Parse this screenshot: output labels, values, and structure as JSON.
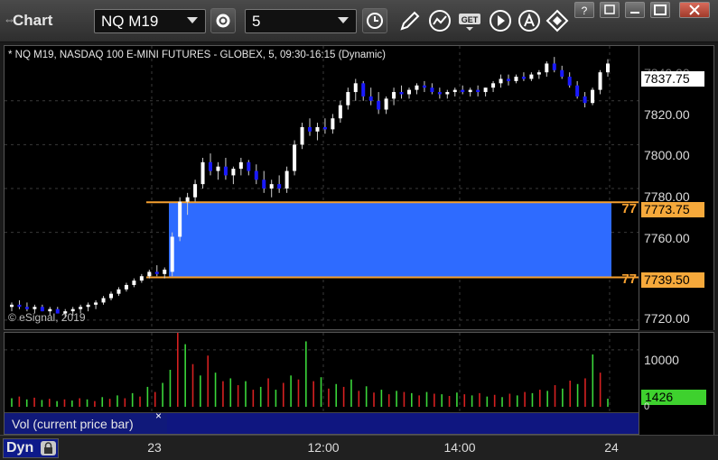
{
  "app": {
    "title": "Chart"
  },
  "toolbar": {
    "symbol": "NQ M19",
    "interval": "5",
    "icons": [
      "gear-icon",
      "clock-icon",
      "pencil-icon",
      "study-icon",
      "get-icon",
      "play-icon",
      "autoscale-icon",
      "cursor-icon"
    ],
    "window_icons": [
      "help-icon",
      "restore-icon",
      "maximize-icon",
      "close-icon"
    ]
  },
  "chart": {
    "header": "* NQ M19, NASDAQ 100 E-MINI FUTURES - GLOBEX, 5, 09:30-16:15 (Dynamic)",
    "copyright": "© eSignal, 2019",
    "price_axis": {
      "ticks": [
        "7820.00",
        "7800.00",
        "7780.00",
        "7760.00",
        "7720.00"
      ],
      "partial_top": "7840.00",
      "last_price": "7837.75",
      "upper_level": "7773.75",
      "lower_level": "7739.50",
      "upper_level_short": "77",
      "lower_level_short": "77"
    },
    "colors": {
      "up_bar": "#ffffff",
      "down_bar": "#1a1aff",
      "zone": "#2e6bff",
      "level_line": "#f5a030"
    }
  },
  "volume": {
    "legend_label": "Vol (current price bar)",
    "close_glyph": "×",
    "axis_tick": "10000",
    "axis_zero": "0",
    "current_value": "1426",
    "colors": {
      "up": "#3ad63a",
      "down": "#d62020"
    }
  },
  "time_axis": {
    "dyn_label": "Dyn",
    "ticks": [
      "23",
      "12:00",
      "14:00",
      "24"
    ]
  },
  "chart_data": {
    "type": "candlestick",
    "price_range": [
      7715,
      7845
    ],
    "zone": {
      "high": 7773.75,
      "low": 7739.5
    },
    "candles": [
      [
        7726,
        7728,
        7724,
        7727
      ],
      [
        7727,
        7729,
        7725,
        7726
      ],
      [
        7726,
        7728,
        7724,
        7725
      ],
      [
        7725,
        7727,
        7723,
        7726
      ],
      [
        7726,
        7727,
        7724,
        7724
      ],
      [
        7724,
        7726,
        7722,
        7725
      ],
      [
        7725,
        7726,
        7723,
        7723
      ],
      [
        7723,
        7725,
        7721,
        7724
      ],
      [
        7724,
        7726,
        7722,
        7725
      ],
      [
        7725,
        7727,
        7723,
        7726
      ],
      [
        7726,
        7728,
        7724,
        7727
      ],
      [
        7727,
        7729,
        7725,
        7728
      ],
      [
        7728,
        7731,
        7727,
        7730
      ],
      [
        7730,
        7733,
        7729,
        7732
      ],
      [
        7732,
        7735,
        7731,
        7734
      ],
      [
        7734,
        7737,
        7733,
        7736
      ],
      [
        7736,
        7739,
        7735,
        7738
      ],
      [
        7738,
        7741,
        7737,
        7740
      ],
      [
        7740,
        7743,
        7739,
        7742
      ],
      [
        7742,
        7745,
        7740,
        7741
      ],
      [
        7741,
        7744,
        7739,
        7743
      ],
      [
        7742,
        7760,
        7740,
        7758
      ],
      [
        7758,
        7776,
        7756,
        7774
      ],
      [
        7774,
        7778,
        7768,
        7776
      ],
      [
        7776,
        7784,
        7774,
        7782
      ],
      [
        7782,
        7794,
        7780,
        7792
      ],
      [
        7792,
        7796,
        7786,
        7788
      ],
      [
        7788,
        7792,
        7784,
        7790
      ],
      [
        7790,
        7794,
        7784,
        7786
      ],
      [
        7786,
        7790,
        7782,
        7789
      ],
      [
        7789,
        7794,
        7786,
        7792
      ],
      [
        7792,
        7793,
        7786,
        7788
      ],
      [
        7788,
        7791,
        7782,
        7784
      ],
      [
        7784,
        7788,
        7778,
        7780
      ],
      [
        7780,
        7784,
        7776,
        7782
      ],
      [
        7782,
        7786,
        7778,
        7780
      ],
      [
        7780,
        7790,
        7778,
        7788
      ],
      [
        7788,
        7802,
        7786,
        7800
      ],
      [
        7800,
        7810,
        7798,
        7808
      ],
      [
        7808,
        7812,
        7804,
        7806
      ],
      [
        7806,
        7810,
        7802,
        7808
      ],
      [
        7808,
        7812,
        7805,
        7807
      ],
      [
        7807,
        7814,
        7805,
        7812
      ],
      [
        7812,
        7820,
        7810,
        7818
      ],
      [
        7818,
        7826,
        7816,
        7824
      ],
      [
        7824,
        7830,
        7820,
        7828
      ],
      [
        7828,
        7829,
        7820,
        7822
      ],
      [
        7822,
        7826,
        7818,
        7820
      ],
      [
        7820,
        7824,
        7814,
        7816
      ],
      [
        7816,
        7822,
        7814,
        7821
      ],
      [
        7821,
        7826,
        7818,
        7824
      ],
      [
        7824,
        7827,
        7821,
        7823
      ],
      [
        7823,
        7826,
        7821,
        7825
      ],
      [
        7825,
        7828,
        7823,
        7827
      ],
      [
        7827,
        7829,
        7824,
        7826
      ],
      [
        7826,
        7828,
        7823,
        7824
      ],
      [
        7824,
        7826,
        7821,
        7823
      ],
      [
        7823,
        7825,
        7821,
        7824
      ],
      [
        7824,
        7826,
        7822,
        7825
      ],
      [
        7825,
        7827,
        7823,
        7824
      ],
      [
        7824,
        7826,
        7822,
        7825
      ],
      [
        7825,
        7827,
        7822,
        7824
      ],
      [
        7824,
        7826,
        7822,
        7826
      ],
      [
        7826,
        7829,
        7824,
        7828
      ],
      [
        7828,
        7832,
        7826,
        7830
      ],
      [
        7830,
        7832,
        7827,
        7829
      ],
      [
        7829,
        7832,
        7828,
        7831
      ],
      [
        7831,
        7833,
        7829,
        7830
      ],
      [
        7830,
        7833,
        7829,
        7832
      ],
      [
        7832,
        7834,
        7830,
        7833
      ],
      [
        7833,
        7838,
        7831,
        7837
      ],
      [
        7837,
        7840,
        7833,
        7834
      ],
      [
        7834,
        7836,
        7830,
        7831
      ],
      [
        7831,
        7833,
        7826,
        7827
      ],
      [
        7827,
        7829,
        7821,
        7822
      ],
      [
        7822,
        7824,
        7817,
        7819
      ],
      [
        7819,
        7826,
        7818,
        7825
      ],
      [
        7825,
        7834,
        7823,
        7833
      ],
      [
        7833,
        7839,
        7831,
        7837
      ]
    ],
    "volume": {
      "range": [
        0,
        13000
      ],
      "bars": [
        [
          "u",
          1500
        ],
        [
          "d",
          1800
        ],
        [
          "u",
          1300
        ],
        [
          "d",
          1600
        ],
        [
          "u",
          1200
        ],
        [
          "d",
          1400
        ],
        [
          "u",
          1000
        ],
        [
          "d",
          1300
        ],
        [
          "u",
          1100
        ],
        [
          "d",
          1500
        ],
        [
          "u",
          1300
        ],
        [
          "d",
          1000
        ],
        [
          "u",
          1700
        ],
        [
          "d",
          1400
        ],
        [
          "u",
          2000
        ],
        [
          "d",
          1500
        ],
        [
          "u",
          2400
        ],
        [
          "d",
          1800
        ],
        [
          "u",
          3500
        ],
        [
          "d",
          2600
        ],
        [
          "u",
          4200
        ],
        [
          "u",
          6500
        ],
        [
          "d",
          13000
        ],
        [
          "u",
          11000
        ],
        [
          "d",
          7500
        ],
        [
          "u",
          5500
        ],
        [
          "d",
          9000
        ],
        [
          "u",
          6000
        ],
        [
          "d",
          4500
        ],
        [
          "u",
          5000
        ],
        [
          "d",
          3800
        ],
        [
          "u",
          4500
        ],
        [
          "d",
          3000
        ],
        [
          "u",
          3500
        ],
        [
          "d",
          5000
        ],
        [
          "u",
          3000
        ],
        [
          "d",
          4200
        ],
        [
          "u",
          5500
        ],
        [
          "d",
          4800
        ],
        [
          "u",
          11500
        ],
        [
          "d",
          4500
        ],
        [
          "u",
          5200
        ],
        [
          "d",
          3200
        ],
        [
          "u",
          4000
        ],
        [
          "d",
          3500
        ],
        [
          "u",
          4800
        ],
        [
          "d",
          2800
        ],
        [
          "u",
          3600
        ],
        [
          "d",
          2500
        ],
        [
          "u",
          3000
        ],
        [
          "d",
          2200
        ],
        [
          "u",
          2800
        ],
        [
          "d",
          2600
        ],
        [
          "u",
          2400
        ],
        [
          "d",
          2000
        ],
        [
          "u",
          2600
        ],
        [
          "d",
          2300
        ],
        [
          "u",
          2200
        ],
        [
          "d",
          1900
        ],
        [
          "u",
          2500
        ],
        [
          "d",
          2200
        ],
        [
          "u",
          2000
        ],
        [
          "d",
          2400
        ],
        [
          "u",
          1800
        ],
        [
          "d",
          2100
        ],
        [
          "u",
          1700
        ],
        [
          "d",
          2300
        ],
        [
          "u",
          2000
        ],
        [
          "d",
          2600
        ],
        [
          "u",
          2400
        ],
        [
          "d",
          3000
        ],
        [
          "u",
          2800
        ],
        [
          "d",
          3800
        ],
        [
          "u",
          3200
        ],
        [
          "d",
          4600
        ],
        [
          "u",
          4000
        ],
        [
          "d",
          5000
        ],
        [
          "u",
          9200
        ],
        [
          "d",
          6000
        ],
        [
          "u",
          1426
        ]
      ]
    }
  }
}
